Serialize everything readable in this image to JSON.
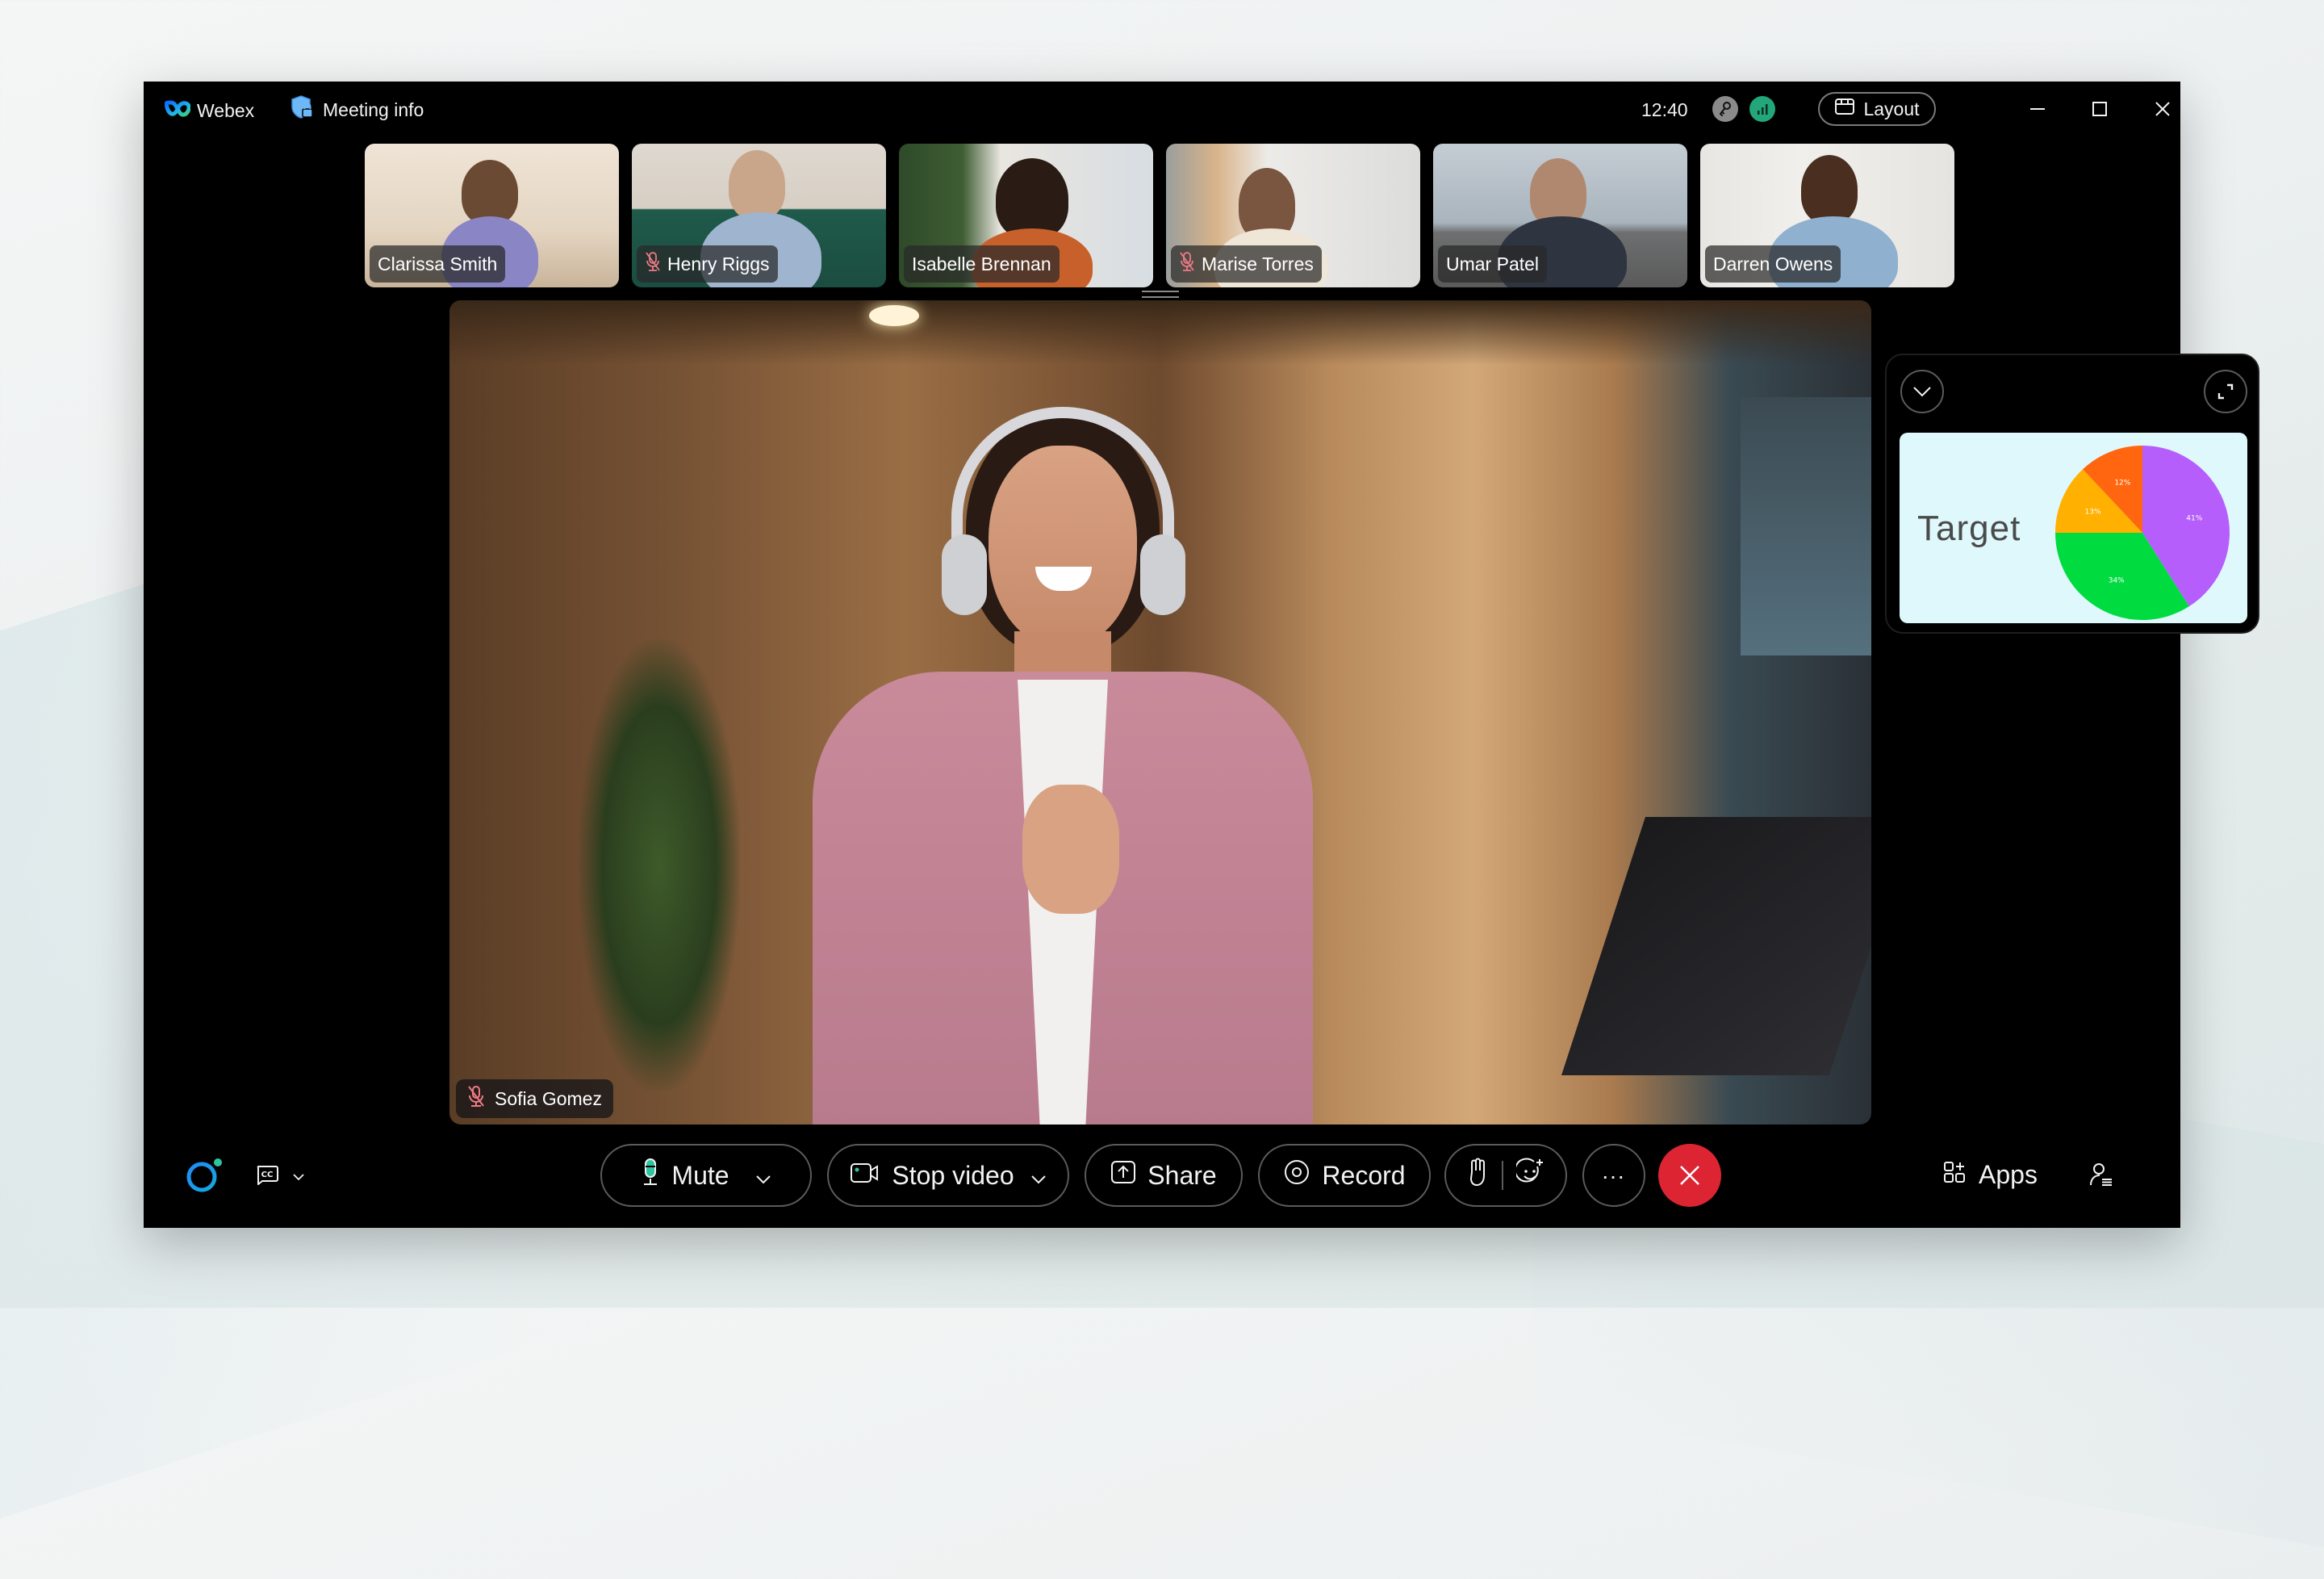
{
  "titlebar": {
    "app_name": "Webex",
    "meeting_info_label": "Meeting info",
    "time": "12:40",
    "layout_label": "Layout",
    "status_icons": [
      "key-icon",
      "signal-strength-icon"
    ],
    "window_controls": [
      "minimize",
      "maximize",
      "close"
    ]
  },
  "participants": [
    {
      "name": "Clarissa Smith",
      "muted": false
    },
    {
      "name": "Henry Riggs",
      "muted": true
    },
    {
      "name": "Isabelle Brennan",
      "muted": false
    },
    {
      "name": "Marise Torres",
      "muted": true
    },
    {
      "name": "Umar Patel",
      "muted": false
    },
    {
      "name": "Darren Owens",
      "muted": false
    }
  ],
  "active_speaker": {
    "name": "Sofia Gomez",
    "muted": true
  },
  "side_panel": {
    "card_title": "Target",
    "controls": [
      "collapse-chevron",
      "expand"
    ]
  },
  "chart_data": {
    "type": "pie",
    "title": "Target",
    "categories": [
      "Purple",
      "Green",
      "Amber",
      "Orange"
    ],
    "values": [
      41,
      34,
      13,
      12
    ],
    "labels": [
      "41%",
      "34%",
      "13%",
      "12%"
    ],
    "colors": [
      "#B55EFC",
      "#00DB40",
      "#FFB000",
      "#FF660F"
    ],
    "start_angle": "12 o'clock",
    "direction": "clockwise"
  },
  "toolbar": {
    "mute_label": "Mute",
    "stop_video_label": "Stop video",
    "share_label": "Share",
    "record_label": "Record",
    "more_label": "...",
    "apps_label": "Apps",
    "cc_label": "CC"
  },
  "colors": {
    "accent_green": "#2EC4A0",
    "end_call_red": "#DC2433",
    "muted_red": "#F07A85",
    "webex_blue": "#1D8CF8"
  }
}
